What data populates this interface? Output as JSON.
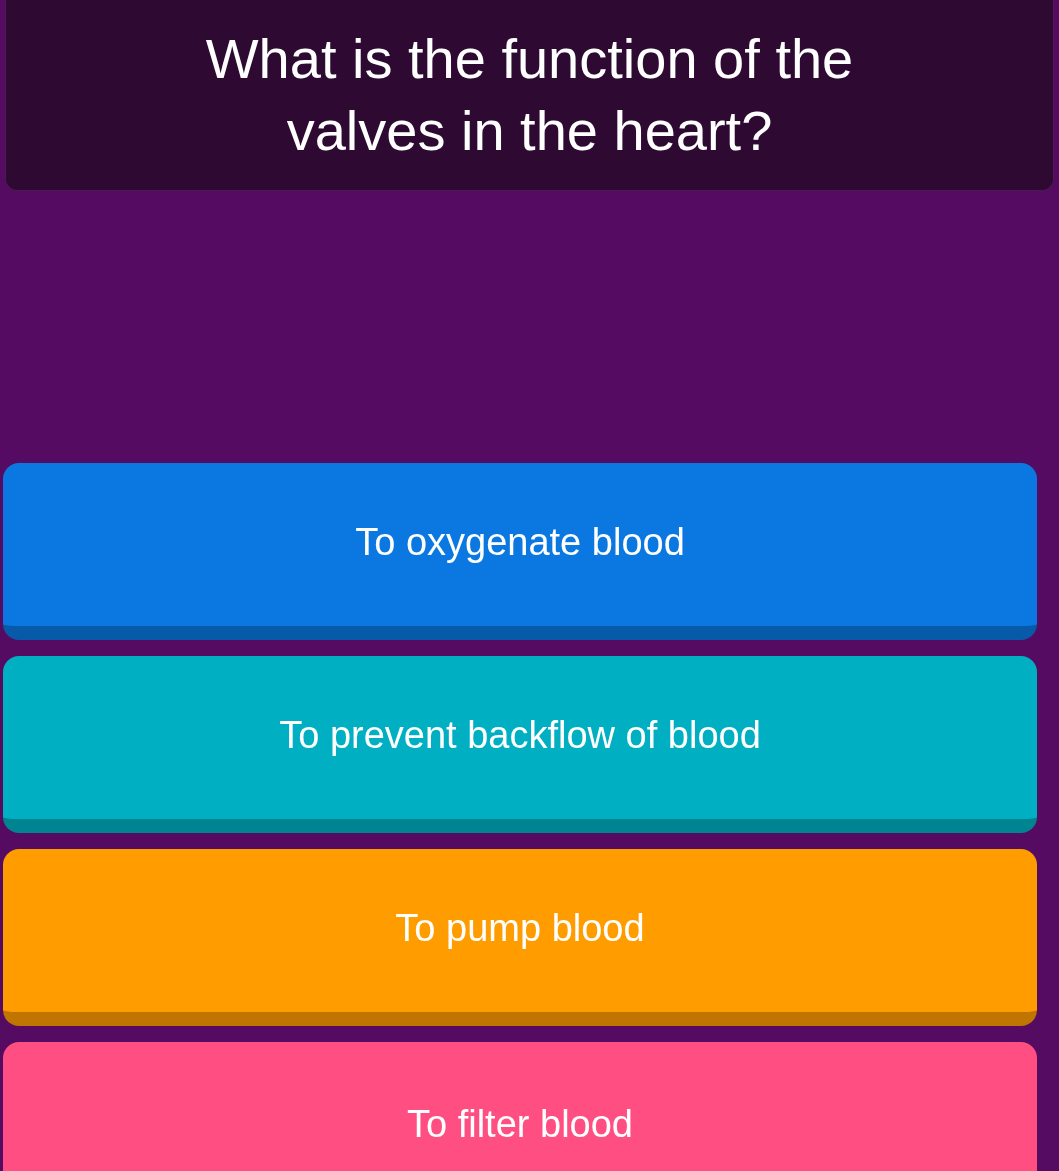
{
  "question": "What is the function of the valves in the heart?",
  "answers": [
    {
      "label": "To oxygenate blood",
      "color": "#0a78e0"
    },
    {
      "label": "To prevent backflow of blood",
      "color": "#00b0c2"
    },
    {
      "label": "To pump blood",
      "color": "#ff9d00"
    },
    {
      "label": "To filter blood",
      "color": "#ff4f82"
    }
  ]
}
